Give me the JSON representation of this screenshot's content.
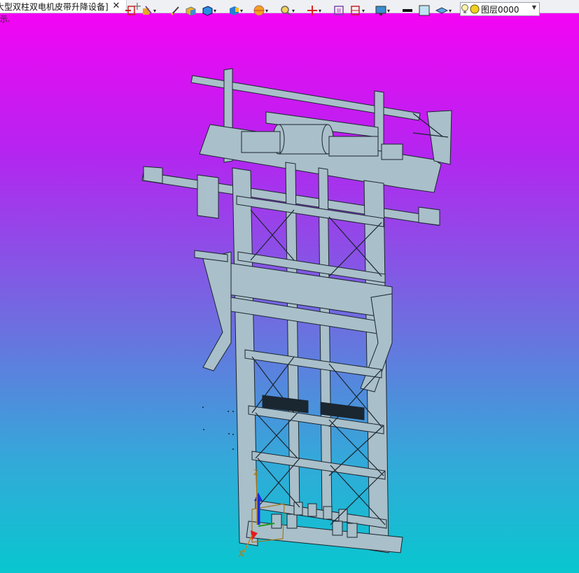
{
  "tab": {
    "title": "大型双柱双电机皮带升降设备]",
    "close_icon": "✕",
    "add_icon": "+"
  },
  "viewport": {
    "hint_text": "示."
  },
  "layer": {
    "value": "图层0000"
  },
  "axes": {
    "x_label": "X",
    "z_label": "Z"
  },
  "colors": {
    "gradient_top": "#f404f4",
    "gradient_bottom": "#08c7cf",
    "model_fill": "#a9bfc9",
    "model_stroke": "#1a2630"
  }
}
